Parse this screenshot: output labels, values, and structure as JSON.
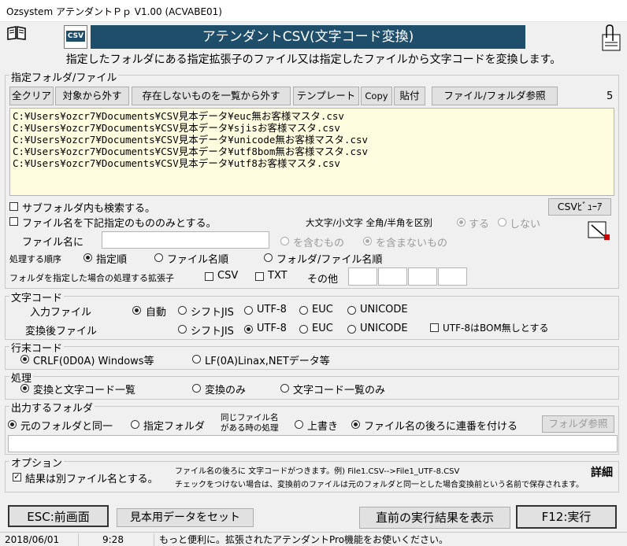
{
  "window": {
    "title": "Ozsystem アテンダントＰｐ V1.00 (ACVABE01)"
  },
  "header": {
    "csv_icon_text": "CSV",
    "banner": "アテンダントCSV(文字コード変換)",
    "description": "指定したフォルダにある指定拡張子のファイル又は指定したファイルから文字コードを変換します。"
  },
  "folder_group": {
    "label": "指定フォルダ/ファイル",
    "buttons": {
      "clear_all": "全クリア",
      "remove_target": "対象から外す",
      "remove_missing": "存在しないものを一覧から外す",
      "template": "テンプレート",
      "copy": "Copy",
      "paste": "貼付",
      "browse": "ファイル/フォルダ参照"
    },
    "count": "5",
    "files": [
      "C:¥Users¥ozcr7¥Documents¥CSV見本データ¥euc無お客様マスタ.csv",
      "C:¥Users¥ozcr7¥Documents¥CSV見本データ¥sjisお客様マスタ.csv",
      "C:¥Users¥ozcr7¥Documents¥CSV見本データ¥unicode無お客様マスタ.csv",
      "C:¥Users¥ozcr7¥Documents¥CSV見本データ¥utf8bom無お客様マスタ.csv",
      "C:¥Users¥ozcr7¥Documents¥CSV見本データ¥utf8お客様マスタ.csv"
    ],
    "search_subfolders": "サブフォルダ内も検索する。",
    "filename_filter": "ファイル名を下記指定のもののみとする。",
    "csv_viewer": "CSVﾋﾞｭｰｱ",
    "case_label": "大文字/小文字 全角/半角を区別",
    "case_yes": "する",
    "case_no": "しない",
    "filename_label": "ファイル名に",
    "contains": "を含むもの",
    "not_contains": "を含まないもの",
    "order_label": "処理する順序",
    "order_specified": "指定順",
    "order_filename": "ファイル名順",
    "order_path": "フォルダ/ファイル名順",
    "ext_label": "フォルダを指定した場合の処理する拡張子",
    "ext_csv": "CSV",
    "ext_txt": "TXT",
    "ext_other": "その他"
  },
  "encoding_group": {
    "label": "文字コード",
    "input_label": "入力ファイル",
    "output_label": "変換後ファイル",
    "auto": "自動",
    "sjis": "シフトJIS",
    "utf8": "UTF-8",
    "euc": "EUC",
    "unicode": "UNICODE",
    "no_bom": "UTF-8はBOM無しとする"
  },
  "eol_group": {
    "label": "行末コード",
    "crlf": "CRLF(0D0A) Windows等",
    "lf": "LF(0A)Linax,NETデータ等"
  },
  "process_group": {
    "label": "処理",
    "both": "変換と文字コード一覧",
    "convert_only": "変換のみ",
    "list_only": "文字コード一覧のみ"
  },
  "output_group": {
    "label": "出力するフォルダ",
    "same_folder": "元のフォルダと同一",
    "specified_folder": "指定フォルダ",
    "same_name_line1": "同じファイル名",
    "same_name_line2": "がある時の処理",
    "overwrite": "上書き",
    "serial": "ファイル名の後ろに連番を付ける",
    "folder_browse": "フォルダ参照"
  },
  "option_group": {
    "label": "オプション",
    "separate_file": "結果は別ファイル名とする。",
    "note1": "ファイル名の後ろに 文字コードがつきます。例) File1.CSV-->File1_UTF-8.CSV",
    "note2": "チェックをつけない場合は、変換前のファイルは元のフォルダと同一とした場合変換前という名前で保存されます。",
    "details": "詳細"
  },
  "footer": {
    "esc": "ESC:前画面",
    "sample": "見本用データをセット",
    "last_result": "直前の実行結果を表示",
    "run": "F12:実行"
  },
  "status": {
    "date": "2018/06/01",
    "time": "9:28",
    "message": "もっと便利に。拡張されたアテンダントPro機能をお使いください。"
  }
}
